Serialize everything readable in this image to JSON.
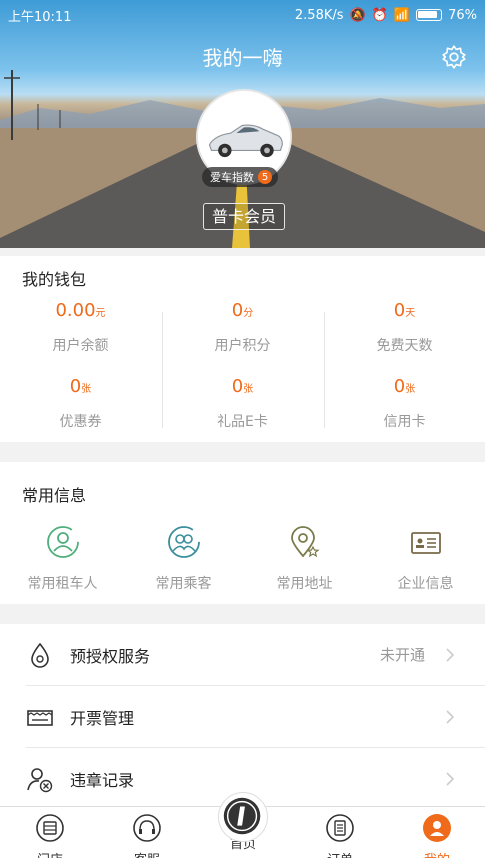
{
  "status_bar": {
    "time": "上午10:11",
    "network_speed": "2.58K/s",
    "battery": "76%"
  },
  "header": {
    "title": "我的一嗨",
    "settings_icon": "gear-icon",
    "car_index_label": "爱车指数",
    "car_index_value": "5",
    "member_level": "普卡会员"
  },
  "wallet": {
    "title": "我的钱包",
    "items": [
      {
        "value": "0.00",
        "unit": "元",
        "label": "用户余额"
      },
      {
        "value": "0",
        "unit": "分",
        "label": "用户积分"
      },
      {
        "value": "0",
        "unit": "天",
        "label": "免费天数"
      },
      {
        "value": "0",
        "unit": "张",
        "label": "优惠券"
      },
      {
        "value": "0",
        "unit": "张",
        "label": "礼品E卡"
      },
      {
        "value": "0",
        "unit": "张",
        "label": "信用卡"
      }
    ]
  },
  "common_info": {
    "title": "常用信息",
    "items": [
      {
        "label": "常用租车人",
        "icon": "renter-icon"
      },
      {
        "label": "常用乘客",
        "icon": "passengers-icon"
      },
      {
        "label": "常用地址",
        "icon": "location-icon"
      },
      {
        "label": "企业信息",
        "icon": "company-card-icon"
      }
    ]
  },
  "menu": [
    {
      "label": "预授权服务",
      "status": "未开通",
      "icon": "preauth-icon"
    },
    {
      "label": "开票管理",
      "status": "",
      "icon": "invoice-icon"
    },
    {
      "label": "违章记录",
      "status": "",
      "icon": "violation-icon"
    }
  ],
  "tabbar": {
    "items": [
      {
        "label": "门店",
        "icon": "store-icon"
      },
      {
        "label": "客服",
        "icon": "headset-icon"
      },
      {
        "label": "首页",
        "icon": "home-logo-icon"
      },
      {
        "label": "订单",
        "icon": "order-icon"
      },
      {
        "label": "我的",
        "icon": "me-icon"
      }
    ],
    "active": "我的"
  },
  "colors": {
    "accent": "#f06a1b",
    "green_icon": "#4fae7b",
    "teal_icon": "#3a8f9a",
    "olive_icon": "#7a7a4a"
  }
}
